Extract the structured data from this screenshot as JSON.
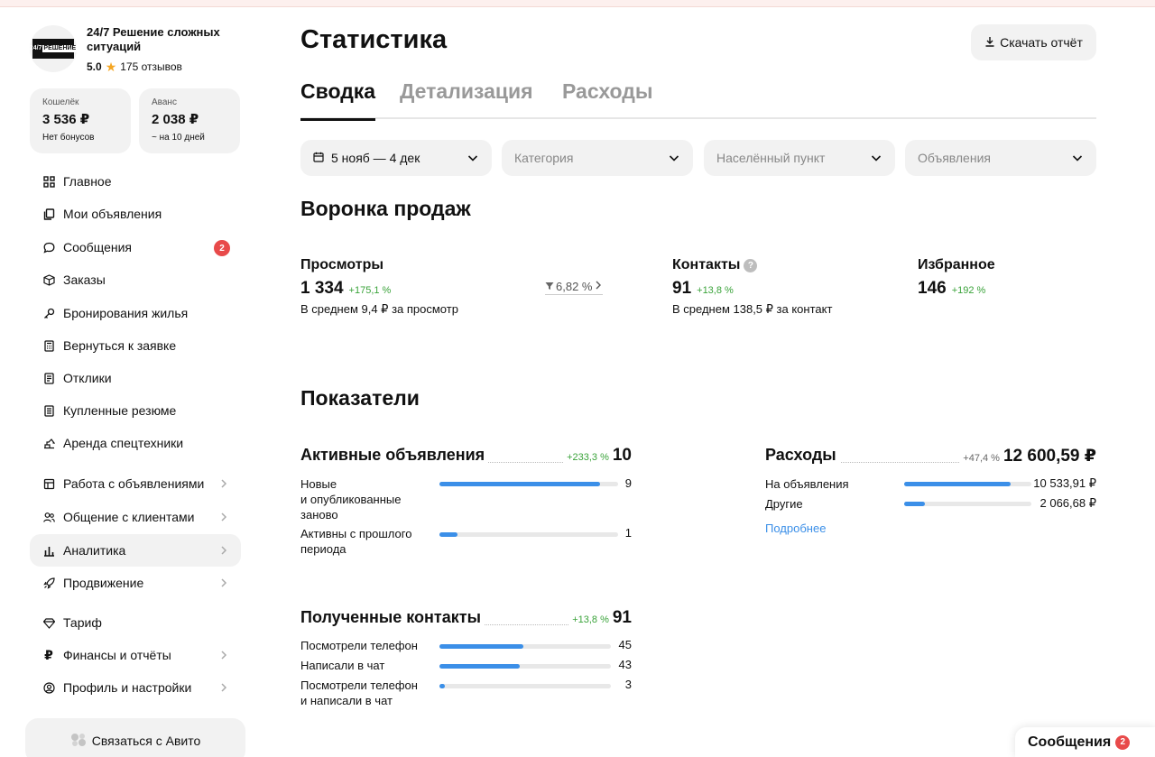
{
  "profile": {
    "name": "24/7 Решение сложных ситуаций",
    "logo_text": "24/7",
    "logo_word": "РЕШЕНИЕ",
    "rating": "5.0",
    "reviews": "175 отзывов"
  },
  "wallets": [
    {
      "title": "Кошелёк",
      "value": "3 536 ₽",
      "sub": "Нет бонусов"
    },
    {
      "title": "Аванс",
      "value": "2 038 ₽",
      "sub": "~ на 10 дней"
    }
  ],
  "nav": {
    "items": [
      {
        "label": "Главное"
      },
      {
        "label": "Мои объявления"
      },
      {
        "label": "Сообщения",
        "badge": "2"
      },
      {
        "label": "Заказы"
      },
      {
        "label": "Бронирования жилья"
      },
      {
        "label": "Вернуться к заявке"
      },
      {
        "label": "Отклики"
      },
      {
        "label": "Купленные резюме"
      },
      {
        "label": "Аренда спецтехники"
      },
      {
        "label": "Работа с объявлениями"
      },
      {
        "label": "Общение с клиентами"
      },
      {
        "label": "Аналитика"
      },
      {
        "label": "Продвижение"
      },
      {
        "label": "Тариф"
      },
      {
        "label": "Финансы и отчёты"
      },
      {
        "label": "Профиль и настройки"
      }
    ]
  },
  "contact_avito": "Связаться с Авито",
  "page_title": "Статистика",
  "download_label": "Скачать отчёт",
  "tabs": [
    {
      "label": "Сводка"
    },
    {
      "label": "Детализация"
    },
    {
      "label": "Расходы"
    }
  ],
  "filters": {
    "period": "5 нояб — 4 дек",
    "category": "Категория",
    "city": "Населённый пункт",
    "ads": "Объявления"
  },
  "funnel": {
    "title": "Воронка продаж",
    "views": {
      "title": "Просмотры",
      "value": "1 334",
      "pct": "+175,1 %",
      "sub": "В среднем 9,4 ₽ за просмотр"
    },
    "conversion": "6,82 %",
    "contacts": {
      "title": "Контакты",
      "value": "91",
      "pct": "+13,8 %",
      "sub": "В среднем 138,5 ₽ за контакт"
    },
    "favorites": {
      "title": "Избранное",
      "value": "146",
      "pct": "+192 %"
    }
  },
  "indicators": {
    "title": "Показатели",
    "active_ads": {
      "title": "Активные объявления",
      "pct": "+233,3 %",
      "value": "10",
      "rows": [
        {
          "label": "Новые\nи опубликованные\nзаново",
          "value": "9",
          "fill": 0.9
        },
        {
          "label": "Активны с прошлого\nпериода",
          "value": "1",
          "fill": 0.1
        }
      ]
    },
    "expenses": {
      "title": "Расходы",
      "pct": "+47,4 %",
      "value": "12 600,59 ₽",
      "rows": [
        {
          "label": "На объявления",
          "value": "10 533,91 ₽",
          "fill": 0.84
        },
        {
          "label": "Другие",
          "value": "2 066,68 ₽",
          "fill": 0.16
        }
      ],
      "more": "Подробнее"
    },
    "contacts": {
      "title": "Полученные контакты",
      "pct": "+13,8 %",
      "value": "91",
      "rows": [
        {
          "label": "Посмотрели телефон",
          "value": "45",
          "fill": 0.49
        },
        {
          "label": "Написали в чат",
          "value": "43",
          "fill": 0.47
        },
        {
          "label": "Посмотрели телефон\nи написали в чат",
          "value": "3",
          "fill": 0.03
        }
      ]
    }
  },
  "messages_tab": {
    "label": "Сообщения",
    "badge": "2"
  }
}
